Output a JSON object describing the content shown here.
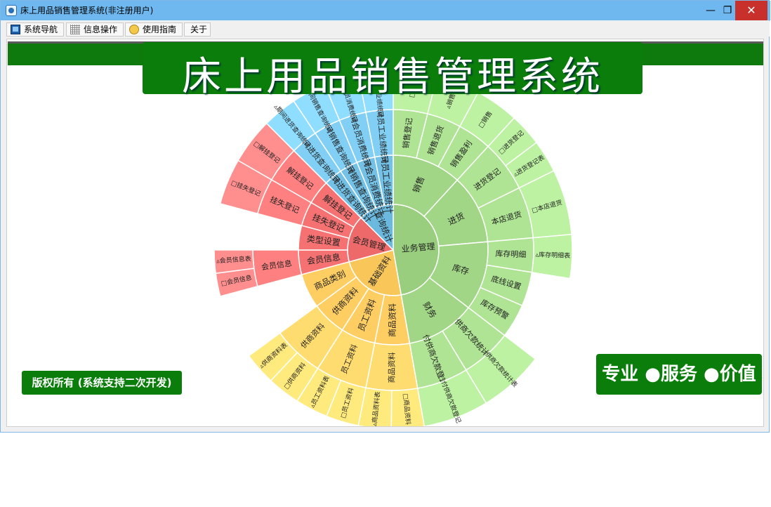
{
  "window": {
    "title": "床上用品销售管理系统(非注册用户)",
    "min_icon": "—",
    "max_icon": "❐",
    "close_icon": "✕"
  },
  "menu": {
    "nav": "系统导航",
    "info": "信息操作",
    "guide": "使用指南",
    "about": "关于"
  },
  "banner": {
    "title": "床上用品销售管理系统"
  },
  "footer": {
    "copyright": "版权所有 (系统支持二次开发)",
    "slogan": "专业 ●服务 ●价值"
  },
  "colors": {
    "business": "#98ce7d",
    "base": "#f9c65a",
    "member": "#ee6a6a",
    "query": "#6bb9de"
  },
  "sunburst": {
    "center_label": "业务管理",
    "sectors": [
      {
        "name": "业务管理",
        "color": "business",
        "children": [
          {
            "name": "销售",
            "children": [
              {
                "name": "销售登记",
                "children": [
                  "□销"
                ]
              },
              {
                "name": "销售退货",
                "children": [
                  "▵销售"
                ]
              },
              {
                "name": "销售盈利",
                "children": [
                  "□销售"
                ]
              }
            ]
          },
          {
            "name": "进货",
            "children": [
              {
                "name": "进货登记",
                "children": [
                  "□进货登记",
                  "▵进货登记表"
                ]
              },
              {
                "name": "本店退货",
                "children": [
                  "□本店退货"
                ]
              }
            ]
          },
          {
            "name": "库存",
            "children": [
              {
                "name": "库存明细",
                "children": [
                  "▵库存明细表"
                ]
              },
              {
                "name": "底线设置",
                "children": []
              },
              {
                "name": "库存预警",
                "children": []
              }
            ]
          },
          {
            "name": "财务",
            "children": [
              {
                "name": "供商欠款统计",
                "children": [
                  "▵供商欠款统计表"
                ]
              },
              {
                "name": "付供商欠款登记",
                "children": [
                  "□付供商欠款登记"
                ]
              }
            ]
          }
        ]
      },
      {
        "name": "基础资料",
        "color": "base",
        "children": [
          {
            "name": "商品资料",
            "children": [
              {
                "name": "商品资料",
                "children": [
                  "□商品资料",
                  "▵商品资料表"
                ]
              }
            ]
          },
          {
            "name": "员工资料",
            "children": [
              {
                "name": "员工资料",
                "children": [
                  "□员工资料",
                  "▵员工资料表"
                ]
              }
            ]
          },
          {
            "name": "供商资料",
            "children": [
              {
                "name": "供商资料",
                "children": [
                  "□供商资料",
                  "▵供商资料表"
                ]
              }
            ]
          },
          {
            "name": "商品类别",
            "children": []
          }
        ]
      },
      {
        "name": "会员管理",
        "color": "member",
        "children": [
          {
            "name": "会员信息",
            "children": [
              {
                "name": "会员信息",
                "children": [
                  "□会员信息",
                  "▵会员信息表"
                ]
              }
            ]
          },
          {
            "name": "类型设置",
            "children": []
          },
          {
            "name": "挂失登记",
            "children": [
              {
                "name": "挂失登记",
                "children": [
                  "□挂失登记"
                ]
              }
            ]
          },
          {
            "name": "解挂登记",
            "children": [
              {
                "name": "解挂登记",
                "children": [
                  "□解挂登记"
                ]
              }
            ]
          }
        ]
      },
      {
        "name": "查询统计",
        "color": "query",
        "children": [
          {
            "name": "期间进货查询统计",
            "children": [
              {
                "name": "期间进货查询统计",
                "children": [
                  "▵期间进货查询统计"
                ]
              }
            ]
          },
          {
            "name": "期间销售查询统计",
            "children": [
              {
                "name": "期间销售查询统计",
                "children": [
                  "▵期间销售查询统计"
                ]
              }
            ]
          },
          {
            "name": "期间会员消费统计",
            "children": [
              {
                "name": "期间会员消费统计",
                "children": [
                  "▵期间会员消费统计"
                ]
              }
            ]
          },
          {
            "name": "期间员工业绩统计",
            "children": [
              {
                "name": "期间员工业绩统计",
                "children": [
                  "▵期间员工业绩统计"
                ]
              }
            ]
          }
        ]
      }
    ]
  }
}
